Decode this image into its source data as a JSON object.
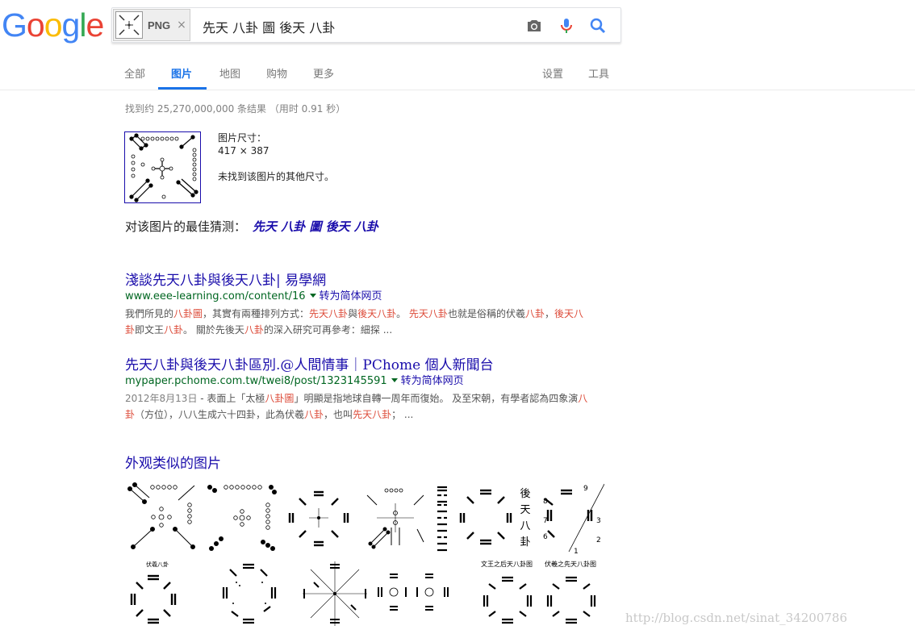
{
  "logo": {
    "letters": [
      "G",
      "o",
      "o",
      "g",
      "l",
      "e"
    ],
    "colors": [
      "#4285f4",
      "#ea4335",
      "#fbbc05",
      "#4285f4",
      "#34a853",
      "#ea4335"
    ]
  },
  "search": {
    "chip_label": "PNG",
    "chip_close": "×",
    "query": "先天 八卦 圖 後天 八卦"
  },
  "icons": {
    "camera": "camera-icon",
    "mic": "mic-icon",
    "search": "search-icon"
  },
  "tabs": [
    {
      "label": "全部"
    },
    {
      "label": "图片"
    },
    {
      "label": "地图"
    },
    {
      "label": "购物"
    },
    {
      "label": "更多"
    },
    {
      "label": "设置"
    },
    {
      "label": "工具"
    }
  ],
  "active_tab": "图片",
  "stats": "找到约 25,270,000,000 条结果 （用时 0.91 秒）",
  "image_info": {
    "size_label": "图片尺寸：",
    "size": "417 × 387",
    "no_other": "未找到该图片的其他尺寸。"
  },
  "guess": {
    "label": "对该图片的最佳猜测：",
    "link": "先天 八卦 圖 後天 八卦"
  },
  "results": [
    {
      "title": "淺談先天八卦與後天八卦| 易學網",
      "url": "www.eee-learning.com/content/16",
      "translate": "转为简体网页",
      "snippet_line1": [
        "我們所見的",
        "八卦圖",
        "，其實有兩種排列方式：",
        "先天八卦",
        "與",
        "後天八卦",
        "。 ",
        "先天八卦",
        "也就是俗稱的伏羲",
        "八卦",
        "，",
        "後天八"
      ],
      "snippet_line2": [
        "卦",
        "即文王",
        "八卦",
        "。 關於先後天",
        "八卦",
        "的深入研究可再參考：細探 ..."
      ]
    },
    {
      "title": "先天八卦與後天八卦區別.@人間情事｜PChome 個人新聞台",
      "url": "mypaper.pchome.com.tw/twei8/post/1323145591",
      "translate": "转为简体网页",
      "date": "2012年8月13日",
      "snippet_line1": [
        " - 表面上「太極",
        "八卦圖",
        "」明顯是指地球自轉一周年而復始。 及至宋朝，有學者認為四象演",
        "八"
      ],
      "snippet_line2": [
        "卦",
        "（方位），八八生成六十四卦，此為伏羲",
        "八卦",
        "，也叫",
        "先天八卦",
        "； ..."
      ]
    }
  ],
  "similar": {
    "title": "外观类似的图片",
    "image_captions": [
      "伏羲八卦",
      "文王之后天八卦图",
      "伏羲之先天八卦图",
      "後",
      "天",
      "八",
      "卦"
    ]
  },
  "watermark": "http://blog.csdn.net/sinat_34200786"
}
